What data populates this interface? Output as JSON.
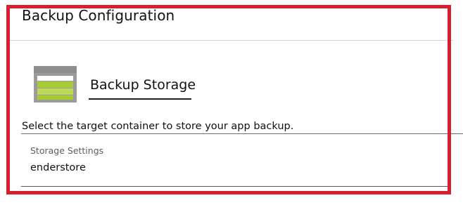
{
  "header": {
    "title": "Backup Configuration"
  },
  "section": {
    "icon": "storage-container-icon",
    "title": "Backup Storage",
    "description": "Select the target container to store your app backup."
  },
  "storage_settings": {
    "label": "Storage Settings",
    "value": "enderstore"
  },
  "colors": {
    "highlight_frame": "#d6202f",
    "icon_gray": "#9b9b9b",
    "icon_green": "#a8cc35"
  }
}
